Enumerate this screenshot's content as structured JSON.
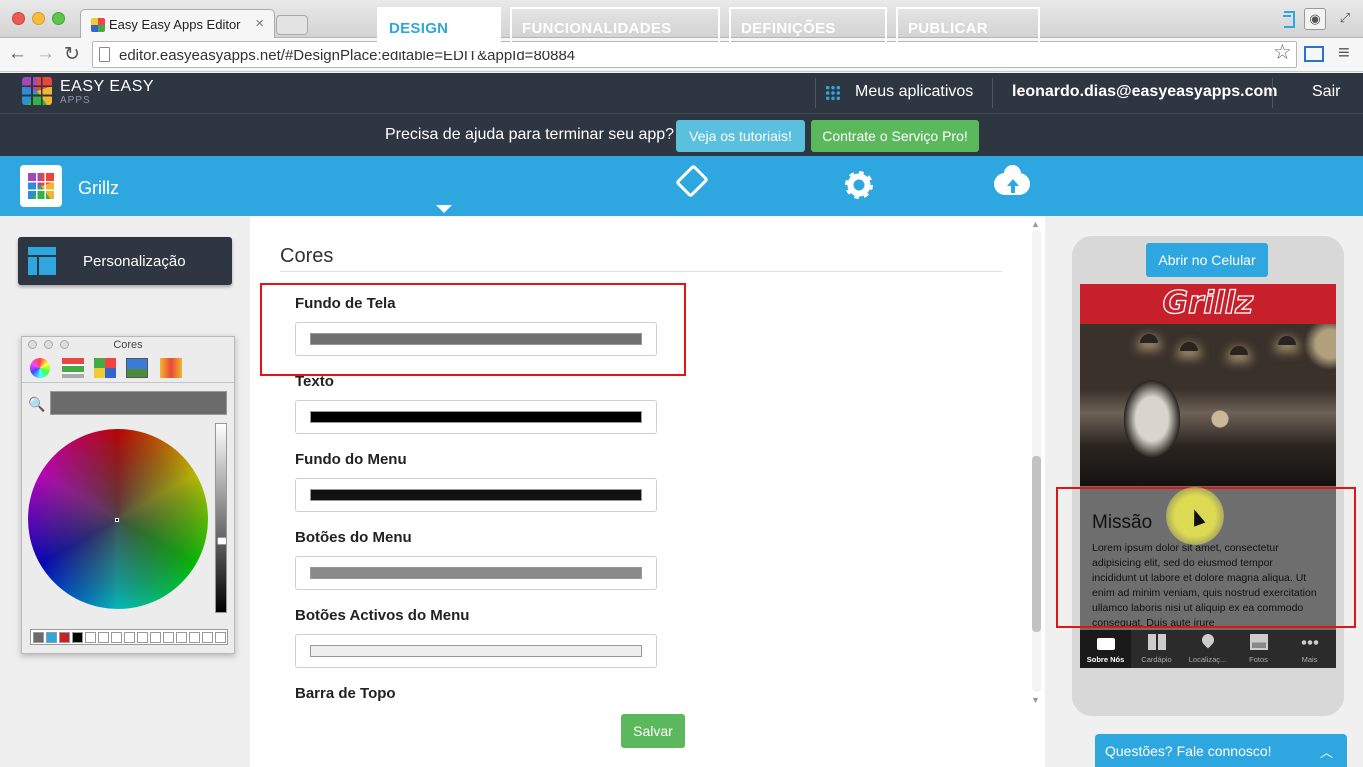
{
  "browser": {
    "tab_title": "Easy Easy Apps Editor",
    "url": "editor.easyeasyapps.net/#DesignPlace:editable=EDIT&appId=80884"
  },
  "header": {
    "logo_name": "EASY EASY",
    "logo_sub": "APPS",
    "my_apps": "Meus aplicativos",
    "email": "leonardo.dias@easyeasyapps.com",
    "logout": "Sair"
  },
  "help": {
    "text": "Precisa de ajuda para terminar seu app?",
    "tutorials": "Veja os tutoriais!",
    "pro": "Contrate o Serviço Pro!"
  },
  "nav": {
    "app_name": "Grillz",
    "tabs": [
      {
        "label": "DESIGN",
        "active": true
      },
      {
        "label": "FUNCIONALIDADES",
        "active": false
      },
      {
        "label": "DEFINIÇÕES",
        "active": false
      },
      {
        "label": "PUBLICAR",
        "active": false
      }
    ]
  },
  "sidebar": {
    "customization": "Personalização",
    "color_panel_title": "Cores"
  },
  "editor": {
    "section_title": "Cores",
    "fields": [
      {
        "label": "Fundo de Tela",
        "color": "#707070"
      },
      {
        "label": "Texto",
        "color": "#000000"
      },
      {
        "label": "Fundo do Menu",
        "color": "#111111"
      },
      {
        "label": "Botões do Menu",
        "color": "#8a8a8a"
      },
      {
        "label": "Botões Activos do Menu",
        "color": "#eeeeee"
      },
      {
        "label": "Barra de Topo",
        "color": ""
      }
    ],
    "save": "Salvar"
  },
  "preview": {
    "open_on_phone": "Abrir no Celular",
    "app_logo": "Grillz",
    "heading": "Missão",
    "body": "Lorem ipsum dolor sit amet, consectetur adipisicing elit, sed do eiusmod tempor incididunt ut labore et dolore magna aliqua. Ut enim ad minim veniam, quis nostrud exercitation ullamco laboris nisi ut aliquip ex ea commodo consequat. Duis aute irure",
    "menu": [
      {
        "label": "Sobre Nós",
        "icon": "open-sign-icon",
        "active": true
      },
      {
        "label": "Cardápio",
        "icon": "book-icon",
        "active": false
      },
      {
        "label": "Localizaç...",
        "icon": "map-pin-icon",
        "active": false
      },
      {
        "label": "Fotos",
        "icon": "photo-icon",
        "active": false
      },
      {
        "label": "Mais",
        "icon": "more-icon",
        "active": false
      }
    ]
  },
  "chat": {
    "label": "Questões? Fale connosco!"
  },
  "colors": {
    "brand_blue": "#2ea7e0",
    "dark_header": "#2e3641",
    "success_green": "#5cb85c",
    "highlight_red": "#e01515",
    "app_red": "#c8202b"
  }
}
